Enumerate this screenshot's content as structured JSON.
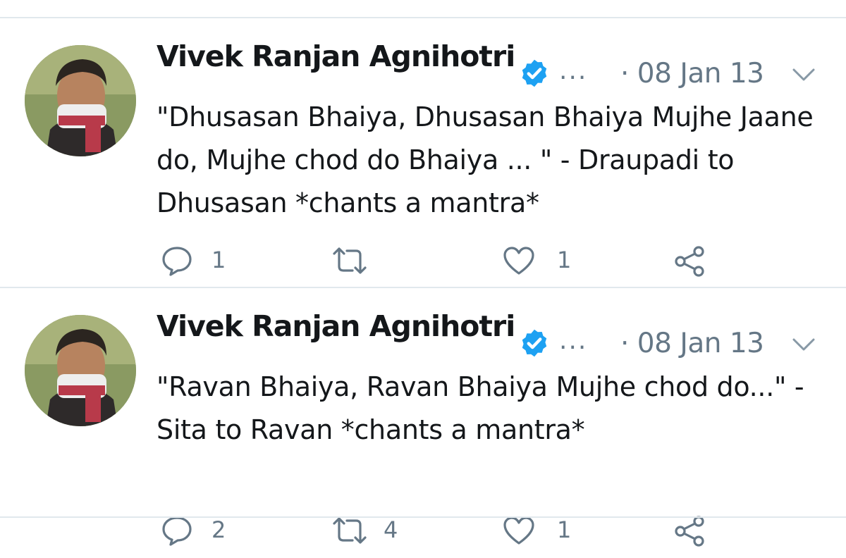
{
  "tweets": [
    {
      "author": "Vivek Ranjan Agnihotri",
      "ellipsis": "...",
      "date": "· 08 Jan 13",
      "text": "\"Dhusasan Bhaiya, Dhusasan Bhaiya Mujhe Jaane do, Mujhe chod do Bhaiya ... \" - Draupadi to Dhusasan *chants a mantra*",
      "replies": "1",
      "retweets": "",
      "likes": "1",
      "icons": [
        "avatar",
        "verified-badge-icon",
        "chevron-down-icon",
        "reply-icon",
        "retweet-icon",
        "like-icon",
        "share-icon"
      ]
    },
    {
      "author": "Vivek Ranjan Agnihotri",
      "ellipsis": "...",
      "date": "· 08 Jan 13",
      "text": "\"Ravan Bhaiya, Ravan Bhaiya Mujhe chod do...\" - Sita to Ravan *chants a mantra*",
      "replies": "2",
      "retweets": "4",
      "likes": "1",
      "icons": [
        "avatar",
        "verified-badge-icon",
        "chevron-down-icon",
        "reply-icon",
        "retweet-icon",
        "like-icon",
        "share-icon"
      ]
    }
  ],
  "colors": {
    "text": "#14171a",
    "muted": "#657786",
    "verified": "#1da1f2",
    "divider": "#e1e8ed"
  }
}
